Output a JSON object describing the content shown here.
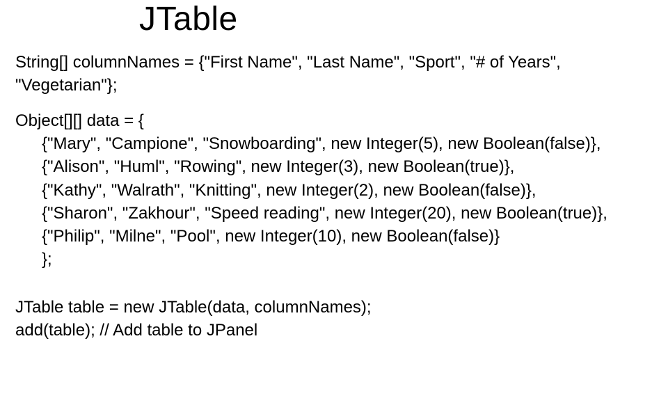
{
  "title": "JTable",
  "code": {
    "columnDecl": "String[] columnNames = {\"First Name\", \"Last Name\", \"Sport\",  \"# of Years\", \"Vegetarian\"};",
    "dataDeclOpen": "Object[][] data = {",
    "rows": [
      "{\"Mary\", \"Campione\", \"Snowboarding\", new Integer(5), new Boolean(false)},",
      "{\"Alison\", \"Huml\", \"Rowing\", new Integer(3), new Boolean(true)},",
      "{\"Kathy\", \"Walrath\", \"Knitting\", new Integer(2), new Boolean(false)},",
      "{\"Sharon\", \"Zakhour\", \"Speed reading\", new Integer(20), new Boolean(true)},",
      "{\"Philip\", \"Milne\", \"Pool\", new Integer(10), new Boolean(false)}"
    ],
    "dataDeclClose": "};",
    "construct": "JTable table = new JTable(data, columnNames);",
    "add": "add(table); // Add table to JPanel"
  },
  "chart_data": {
    "type": "table",
    "title": "JTable example data",
    "columns": [
      "First Name",
      "Last Name",
      "Sport",
      "# of Years",
      "Vegetarian"
    ],
    "rows": [
      [
        "Mary",
        "Campione",
        "Snowboarding",
        5,
        false
      ],
      [
        "Alison",
        "Huml",
        "Rowing",
        3,
        true
      ],
      [
        "Kathy",
        "Walrath",
        "Knitting",
        2,
        false
      ],
      [
        "Sharon",
        "Zakhour",
        "Speed reading",
        20,
        true
      ],
      [
        "Philip",
        "Milne",
        "Pool",
        10,
        false
      ]
    ]
  }
}
